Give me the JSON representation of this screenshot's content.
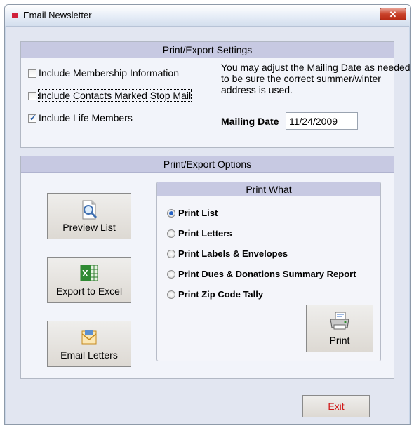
{
  "window": {
    "title": "Email Newsletter",
    "close_label": "✕"
  },
  "settings": {
    "header": "Print/Export Settings",
    "checkboxes": [
      {
        "label": "Include Membership Information",
        "checked": false
      },
      {
        "label": "Include Contacts Marked Stop Mail",
        "checked": false
      },
      {
        "label": "Include Life Members",
        "checked": true
      }
    ],
    "note": "You may adjust the Mailing Date as needed to be sure the correct summer/winter address is used.",
    "mailing_date_label": "Mailing Date",
    "mailing_date_value": "11/24/2009"
  },
  "options": {
    "header": "Print/Export Options",
    "buttons": {
      "preview": "Preview List",
      "excel": "Export to Excel",
      "email": "Email Letters"
    },
    "print_what": {
      "header": "Print What",
      "radios": [
        {
          "label": "Print List",
          "selected": true
        },
        {
          "label": "Print Letters",
          "selected": false
        },
        {
          "label": "Print Labels & Envelopes",
          "selected": false
        },
        {
          "label": "Print Dues & Donations Summary Report",
          "selected": false
        },
        {
          "label": "Print Zip Code Tally",
          "selected": false
        }
      ],
      "print_button": "Print"
    }
  },
  "exit_label": "Exit",
  "icons": {
    "title": "app-icon",
    "preview": "magnifier-document-icon",
    "excel": "excel-icon",
    "email": "envelope-icon",
    "print": "printer-icon"
  }
}
